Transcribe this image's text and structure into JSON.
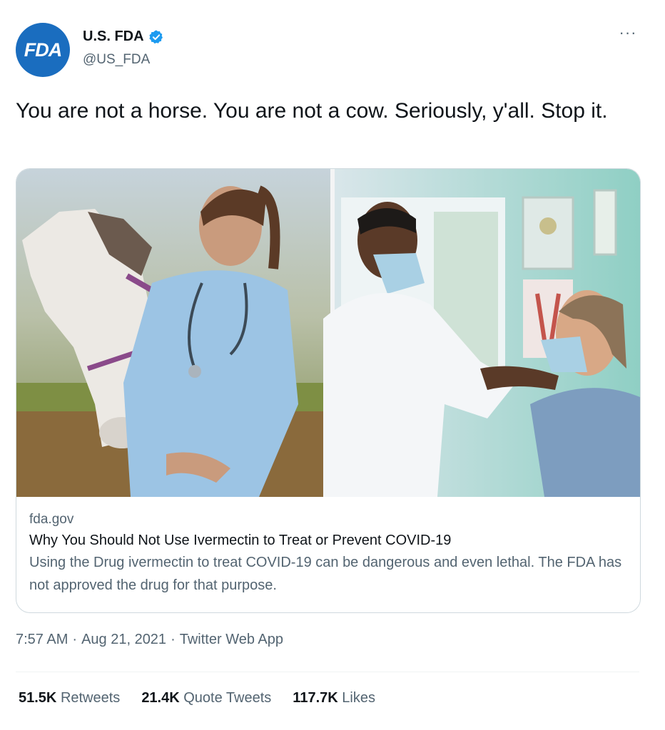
{
  "author": {
    "avatar_text": "FDA",
    "name": "U.S. FDA",
    "handle": "@US_FDA",
    "verified": true
  },
  "more_icon": "···",
  "tweet": {
    "text": "You are not a horse. You are not a cow. Seriously, y'all. Stop it."
  },
  "card": {
    "image_left": "veterinarian in blue scrubs with stethoscope holding a white horse",
    "image_right": "doctor in white coat and mask adjusting a patient's face mask",
    "domain": "fda.gov",
    "title": "Why You Should Not Use Ivermectin to Treat or Prevent COVID-19",
    "description": "Using the Drug ivermectin to treat COVID-19 can be dangerous and even lethal. The FDA has not approved the drug for that purpose."
  },
  "meta": {
    "time": "7:57 AM",
    "separator": "·",
    "date": "Aug 21, 2021",
    "source": "Twitter Web App"
  },
  "stats": {
    "retweets_count": "51.5K",
    "retweets_label": "Retweets",
    "quotes_count": "21.4K",
    "quotes_label": "Quote Tweets",
    "likes_count": "117.7K",
    "likes_label": "Likes"
  },
  "colors": {
    "brand_blue": "#1a6dbf",
    "verified_blue": "#1d9bf0",
    "text_primary": "#0f1419",
    "text_secondary": "#536471"
  }
}
